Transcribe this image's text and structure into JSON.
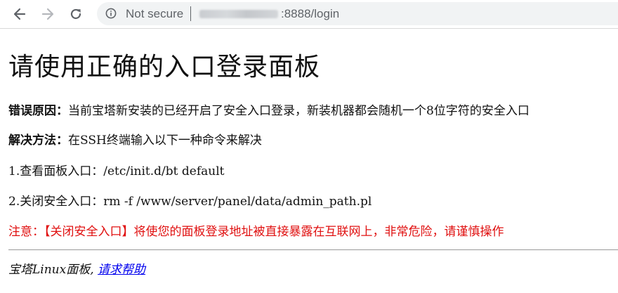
{
  "browser": {
    "security_label": "Not secure",
    "url_path": ":8888/login",
    "nav": {
      "back_icon": "arrow-left-icon",
      "forward_icon": "arrow-right-icon",
      "reload_icon": "reload-icon",
      "info_icon": "info-circle-icon"
    }
  },
  "page": {
    "title": "请使用正确的入口登录面板",
    "reason": {
      "label": "错误原因：",
      "text": "当前宝塔新安装的已经开启了安全入口登录，新装机器都会随机一个8位字符的安全入口"
    },
    "solution": {
      "label": "解决方法：",
      "text": "在SSH终端输入以下一种命令来解决"
    },
    "commands": [
      {
        "text": "1.查看面板入口：/etc/init.d/bt default"
      },
      {
        "text": "2.关闭安全入口：rm -f /www/server/panel/data/admin_path.pl"
      }
    ],
    "warning": "注意：【关闭安全入口】将使您的面板登录地址被直接暴露在互联网上，非常危险，请谨慎操作",
    "footer": {
      "text": "宝塔Linux面板, ",
      "link": "请求帮助"
    }
  },
  "colors": {
    "warning": "#e01010",
    "link": "#0000ee",
    "omnibox_bg": "#f1f3f4",
    "chrome_icon": "#5f6368"
  }
}
